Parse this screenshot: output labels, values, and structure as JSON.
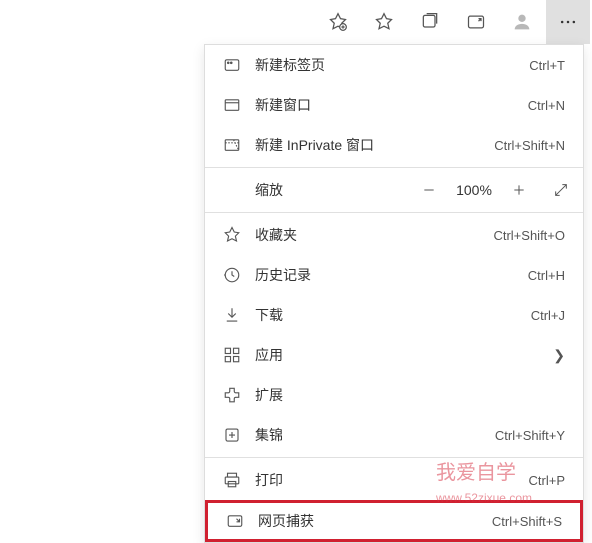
{
  "toolbar": {
    "add_favorite": "add-favorite",
    "favorites": "favorites",
    "collections": "collections",
    "capture": "capture",
    "profile": "profile",
    "more": "more"
  },
  "zoom": {
    "label": "缩放",
    "value": "100%"
  },
  "menu_items": [
    {
      "label": "新建标签页",
      "shortcut": "Ctrl+T",
      "icon": "tab"
    },
    {
      "label": "新建窗口",
      "shortcut": "Ctrl+N",
      "icon": "window"
    },
    {
      "label": "新建 InPrivate 窗口",
      "shortcut": "Ctrl+Shift+N",
      "icon": "inprivate"
    }
  ],
  "menu_items2": [
    {
      "label": "收藏夹",
      "shortcut": "Ctrl+Shift+O",
      "icon": "star"
    },
    {
      "label": "历史记录",
      "shortcut": "Ctrl+H",
      "icon": "history"
    },
    {
      "label": "下载",
      "shortcut": "Ctrl+J",
      "icon": "download"
    },
    {
      "label": "应用",
      "shortcut": "",
      "icon": "apps",
      "chevron": true
    },
    {
      "label": "扩展",
      "shortcut": "",
      "icon": "extensions"
    },
    {
      "label": "集锦",
      "shortcut": "Ctrl+Shift+Y",
      "icon": "collections"
    }
  ],
  "menu_items3": [
    {
      "label": "打印",
      "shortcut": "Ctrl+P",
      "icon": "print"
    },
    {
      "label": "网页捕获",
      "shortcut": "Ctrl+Shift+S",
      "icon": "capture",
      "highlighted": true
    }
  ],
  "watermark": {
    "main": "我爱自学",
    "sub": "www.52zixue.com"
  }
}
